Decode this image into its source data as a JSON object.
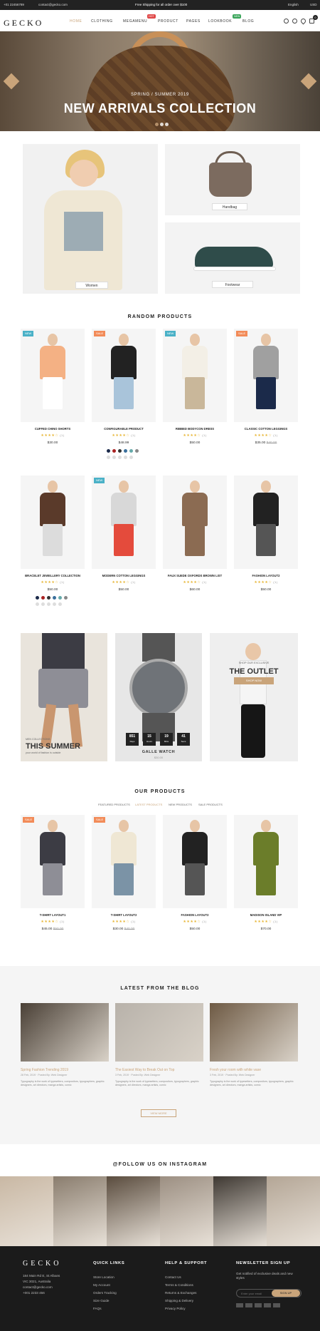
{
  "topbar": {
    "phone": "+01 22456789",
    "email": "contact@gecko.com",
    "promo": "Free Shipping for all order over $100",
    "language": "English",
    "currency": "USD"
  },
  "header": {
    "logo": "GECKO",
    "nav": [
      "HOME",
      "CLOTHING",
      "MEGAMENU",
      "PRODUCT",
      "PAGES",
      "LOOKBOOK",
      "BLOG"
    ],
    "badges": {
      "megamenu": "HOT",
      "lookbook": "NEW"
    },
    "cart_count": "0"
  },
  "hero": {
    "subtitle": "SPRING / SUMMER 2019",
    "title": "NEW ARRIVALS COLLECTION"
  },
  "categories": {
    "women": "Women",
    "handbag": "Handbag",
    "footwear": "Footwear"
  },
  "random_products": {
    "title": "RANDOM PRODUCTS",
    "items": [
      {
        "name": "CUFFED CHINO SHORTS",
        "tag": "NEW",
        "rating": "(1)",
        "price": "$30.00",
        "old": ""
      },
      {
        "name": "CONFIGURABLE PRODUCT",
        "tag": "SALE",
        "rating": "(1)",
        "price": "$48.99",
        "old": ""
      },
      {
        "name": "RIBBED BODYCON DRESS",
        "tag": "NEW",
        "rating": "(1)",
        "price": "$50.00",
        "old": ""
      },
      {
        "name": "CLASSIC COTTON LEGGINGS",
        "tag": "SALE",
        "rating": "(1)",
        "price": "$35.00",
        "old": "$40.00"
      },
      {
        "name": "BRACELET JEWELLERY COLLECTION",
        "tag": "",
        "rating": "(1)",
        "price": "$50.00",
        "old": ""
      },
      {
        "name": "MODERN COTTON LEGGINGS",
        "tag": "NEW",
        "rating": "(1)",
        "price": "$50.00",
        "old": ""
      },
      {
        "name": "FAUX SUEDE OXFORDS BROWN LIST",
        "tag": "",
        "rating": "(1)",
        "price": "$60.00",
        "old": ""
      },
      {
        "name": "FASHION LAYOUT2",
        "tag": "",
        "rating": "(1)",
        "price": "$50.00",
        "old": ""
      }
    ]
  },
  "banners": {
    "summer_kicker": "MEN COLLECTIONS",
    "summer_title": "THIS SUMMER",
    "summer_sub": "your world of fashion is outside",
    "watch_nums": [
      "851",
      "15",
      "19",
      "41"
    ],
    "watch_units": [
      "Days",
      "Hours",
      "Mins",
      "Secs"
    ],
    "watch_title": "GALLE WATCH",
    "watch_price": "$30.00",
    "outlet_kicker": "SHOP OUR EXCLUSIVE",
    "outlet_title": "THE OUTLET",
    "outlet_btn": "SHOP NOW"
  },
  "our_products": {
    "title": "OUR PRODUCTS",
    "tabs": [
      "FEATURED PRODUCTS",
      "LATEST PRODUCTS",
      "NEW PRODUCTS",
      "SALE PRODUCTS"
    ],
    "items": [
      {
        "name": "T-SHIRT LAYOUT1",
        "tag": "SALE",
        "rating": "(1)",
        "price": "$45.00",
        "old": "$50.00"
      },
      {
        "name": "T-SHIRT LAYOUT2",
        "tag": "SALE",
        "rating": "(1)",
        "price": "$30.00",
        "old": "$40.00"
      },
      {
        "name": "FASHION LAYOUT2",
        "tag": "",
        "rating": "(1)",
        "price": "$50.00",
        "old": ""
      },
      {
        "name": "MADISON ISLAND VIP",
        "tag": "",
        "rating": "(1)",
        "price": "$70.00",
        "old": ""
      }
    ]
  },
  "blog": {
    "title": "LATEST FROM THE BLOG",
    "posts": [
      {
        "title": "Spring Fashion Trending 2019",
        "meta": "28 Feb, 2019  ·  Posted By: Web Designer",
        "excerpt": "Typography is the work of typesetters, compositors, typographers, graphic designers, art directors, manga artists, comic"
      },
      {
        "title": "The Easiest Way to Break Out on Top",
        "meta": "3 Feb, 2019  ·  Posted By: Web Designer",
        "excerpt": "Typography is the work of typesetters, compositors, typographers, graphic designers, art directors, manga artists, comic"
      },
      {
        "title": "Fresh your room with white vase",
        "meta": "3 Feb, 2019  ·  Posted By: Web Designer",
        "excerpt": "Typography is the work of typesetters, compositors, typographers, graphic designers, art directors, manga artists, comic"
      }
    ],
    "view_more": "VIEW MORE"
  },
  "instagram": {
    "title": "@FOLLOW US ON INSTAGRAM"
  },
  "footer": {
    "logo": "GECKO",
    "address": [
      "184 Main Rd E, St Albans",
      "VIC 3021, Australia",
      "contact@gecko.com",
      "+001 2233 456"
    ],
    "quick_title": "QUICK LINKS",
    "quick": [
      "Store Location",
      "My Account",
      "Orders Tracking",
      "Size Guide",
      "FAQs"
    ],
    "help_title": "HELP & SUPPORT",
    "help": [
      "Contact Us",
      "Terms & Conditions",
      "Returns & Exchanges",
      "Shipping & Delivery",
      "Privacy Policy"
    ],
    "news_title": "NEWSLETTER SIGN UP",
    "news_text": "Get notified of exclusive deals and new styles",
    "news_placeholder": "Enter your email",
    "news_btn": "SIGN UP"
  },
  "colors": {
    "accent": "#c9a47a",
    "new_tag": "#4ab1c7",
    "sale_tag": "#f28b58",
    "hot_badge": "#e04848",
    "new_badge": "#3aa55a",
    "footer_bg": "#1b1b1b"
  }
}
